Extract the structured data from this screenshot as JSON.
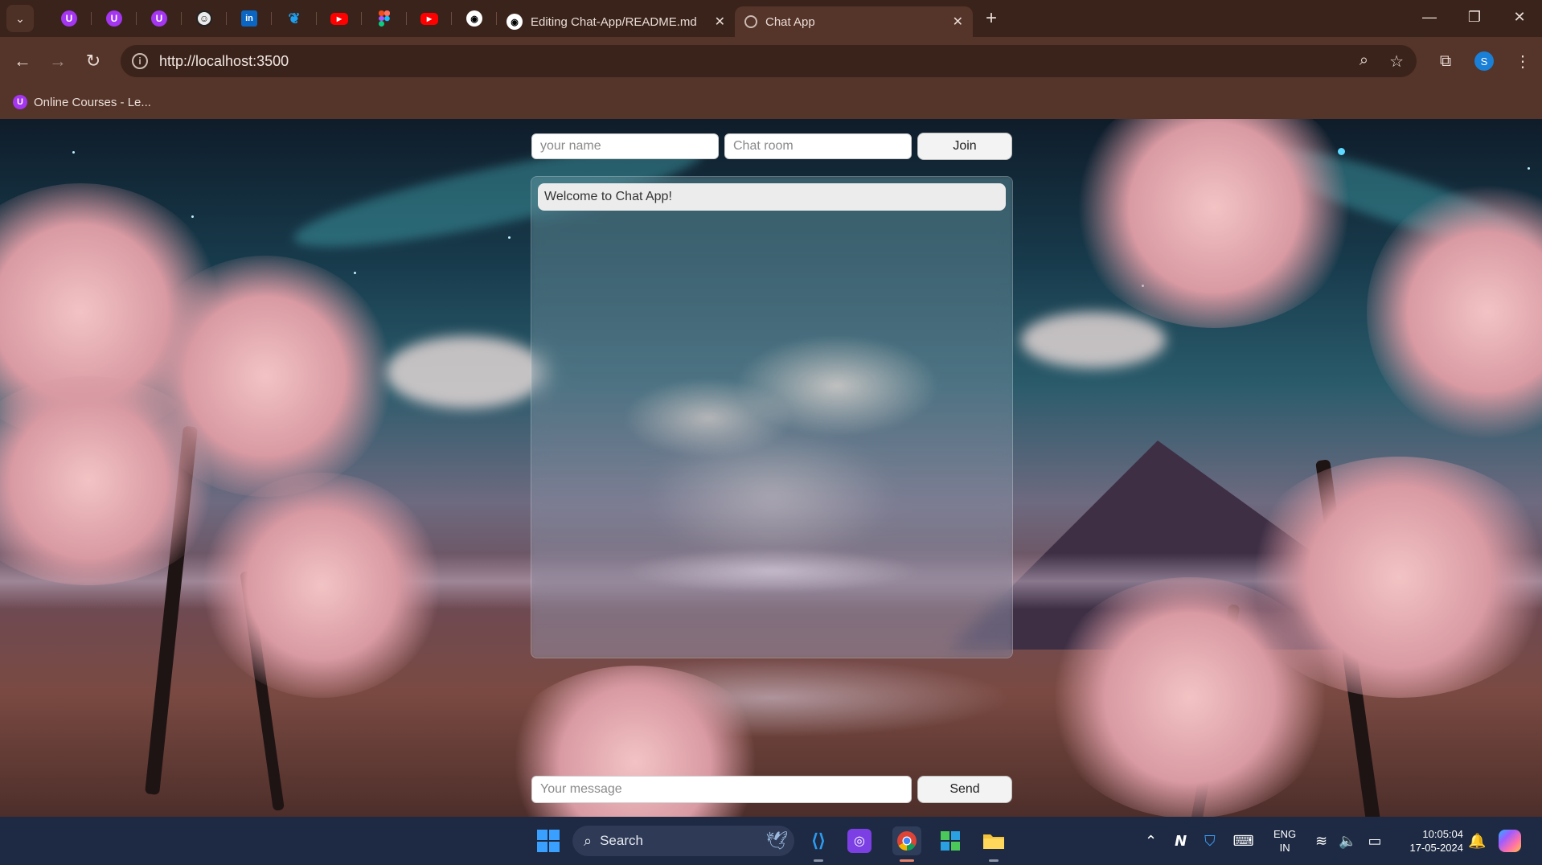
{
  "browser": {
    "pinned_tabs": [
      {
        "icon": "udemy-icon",
        "glyph": "U"
      },
      {
        "icon": "udemy-icon",
        "glyph": "U"
      },
      {
        "icon": "udemy-icon",
        "glyph": "U"
      },
      {
        "icon": "coin-icon",
        "glyph": "☺"
      },
      {
        "icon": "linkedin-icon",
        "glyph": "in"
      },
      {
        "icon": "bird-icon",
        "glyph": "❦"
      },
      {
        "icon": "youtube-icon",
        "glyph": "▶"
      },
      {
        "icon": "figma-icon",
        "glyph": ""
      },
      {
        "icon": "youtube-icon",
        "glyph": "▶"
      },
      {
        "icon": "github-icon",
        "glyph": "◉"
      }
    ],
    "tabs": [
      {
        "title": "Editing Chat-App/README.md",
        "icon": "github-icon"
      },
      {
        "title": "Chat App",
        "icon": "globe-icon",
        "active": true
      }
    ],
    "new_tab_glyph": "+",
    "url": "http://localhost:3500",
    "bookmarks": [
      {
        "label": "Online Courses - Le...",
        "icon": "udemy-icon"
      }
    ],
    "profile_initial": "S"
  },
  "chat": {
    "name_placeholder": "your name",
    "room_placeholder": "Chat room",
    "join_label": "Join",
    "messages": [
      {
        "text": "Welcome to Chat App!"
      }
    ],
    "message_placeholder": "Your message",
    "send_label": "Send"
  },
  "taskbar": {
    "search_label": "Search",
    "lang_line1": "ENG",
    "lang_line2": "IN",
    "time": "10:05:04",
    "date": "17-05-2024"
  },
  "colors": {
    "tabbar_bg": "#3a231a",
    "toolbar_bg": "#553429",
    "taskbar_bg": "#1e2a44",
    "accent": "#a435f0"
  }
}
